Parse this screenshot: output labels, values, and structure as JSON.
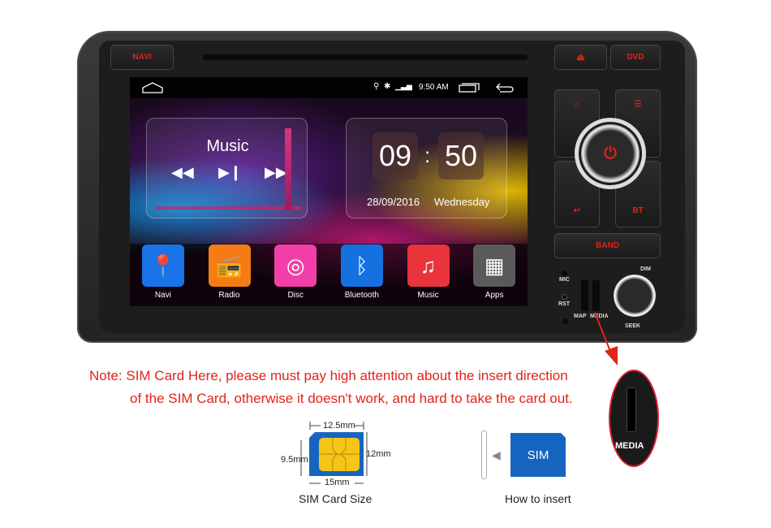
{
  "device": {
    "buttons": {
      "navi": "NAVI",
      "dvd": "DVD",
      "bt": "BT",
      "band": "BAND"
    },
    "labels": {
      "mic": "MIC",
      "rst": "RST",
      "map": "MAP",
      "media": "MEDIA",
      "dim": "DIM",
      "seek": "SEEK"
    },
    "accent": "#e0201a"
  },
  "screen": {
    "status": {
      "time": "9:50 AM",
      "icons": [
        "location-icon",
        "bluetooth-icon",
        "signal-4g-icon"
      ]
    },
    "music_widget": {
      "title": "Music"
    },
    "clock_widget": {
      "hours": "09",
      "minutes": "50",
      "date": "28/09/2016",
      "day": "Wednesday"
    },
    "apps": [
      {
        "label": "Navi",
        "icon": "map-pin-icon",
        "color": "#1a73e8"
      },
      {
        "label": "Radio",
        "icon": "radio-icon",
        "color": "#f57c14"
      },
      {
        "label": "Disc",
        "icon": "disc-icon",
        "color": "#f23fa8"
      },
      {
        "label": "Bluetooth",
        "icon": "bluetooth-icon",
        "color": "#1570e0"
      },
      {
        "label": "Music",
        "icon": "music-note-icon",
        "color": "#e8343a"
      },
      {
        "label": "Apps",
        "icon": "apps-grid-icon",
        "color": "#5a5a5a"
      }
    ]
  },
  "inset": {
    "label": "MEDIA"
  },
  "note": {
    "line1": "Note: SIM Card Here, please must pay high attention about the insert direction",
    "line2": "of the SIM Card, otherwise it doesn't work, and hard to take the card out.",
    "color": "#e0241b"
  },
  "sim_size": {
    "top": "12.5mm",
    "left": "9.5mm",
    "right": "12mm",
    "bottom": "15mm",
    "caption": "SIM Card Size"
  },
  "insert": {
    "card_label": "SIM",
    "caption": "How to insert",
    "color": "#1565c0"
  }
}
